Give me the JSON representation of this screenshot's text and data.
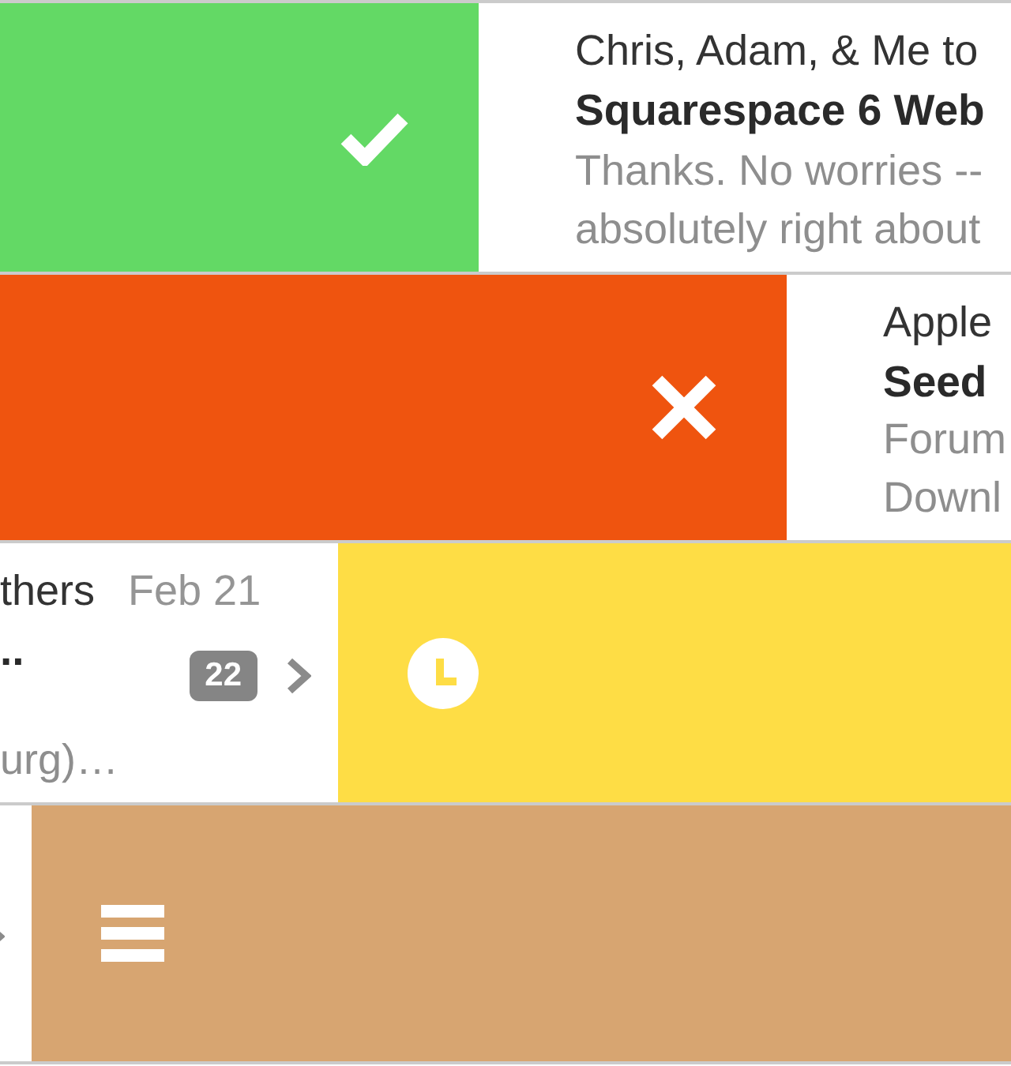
{
  "messages": [
    {
      "action_on_left": true,
      "action": {
        "kind": "done",
        "color": "#63d965"
      },
      "card": {
        "sender": "Chris, Adam, & Me to",
        "subject": "Squarespace 6 Web",
        "preview": [
          "Thanks. No worries --",
          "absolutely right about"
        ]
      }
    },
    {
      "action_on_left": true,
      "action": {
        "kind": "delete",
        "color": "#ef540f"
      },
      "card": {
        "sender": "Apple",
        "subject": "Seed",
        "preview": [
          "Forum",
          "Downl"
        ]
      }
    },
    {
      "action_on_left": false,
      "action": {
        "kind": "later",
        "color": "#fedd45"
      },
      "card": {
        "sender": "thers",
        "date": "Feb 21",
        "subject": "..",
        "preview": [
          "urg)…"
        ],
        "badge": "22",
        "chevron": true
      }
    },
    {
      "action_on_left": false,
      "action": {
        "kind": "list",
        "color": "#d7a571"
      },
      "card": {
        "chevron": true
      }
    }
  ]
}
